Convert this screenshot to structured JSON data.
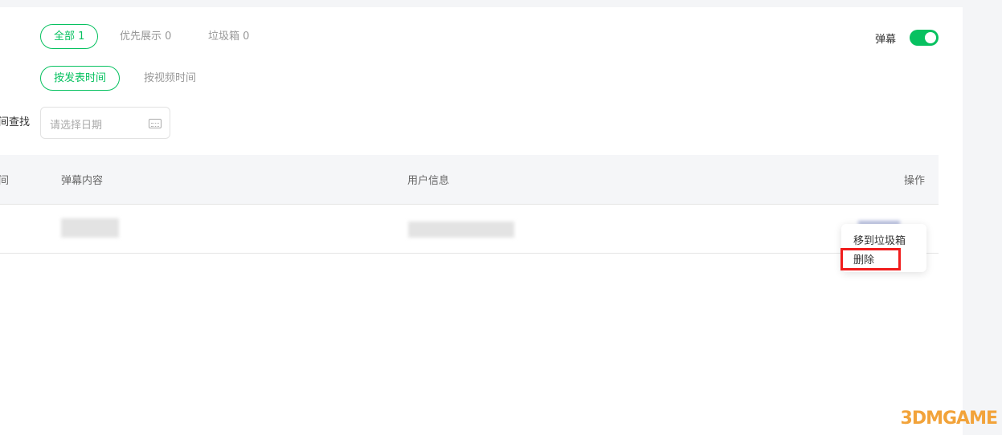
{
  "filters": {
    "tabs": [
      {
        "label": "全部 1",
        "active": true
      },
      {
        "label": "优先展示 0"
      },
      {
        "label": "垃圾箱 0"
      }
    ],
    "sort": [
      {
        "label": "按发表时间",
        "active": true
      },
      {
        "label": "按视频时间"
      }
    ],
    "date_label": "间查找",
    "date_placeholder": "请选择日期"
  },
  "danmaku_toggle": {
    "label": "弹幕",
    "on": true
  },
  "table": {
    "headers": [
      "间",
      "弹幕内容",
      "用户信息",
      "操作"
    ]
  },
  "menu": {
    "items": [
      "移到垃圾箱",
      "删除"
    ],
    "highlighted": "删除"
  },
  "watermark": "3DMGAME",
  "colors": {
    "accent": "#07c160",
    "highlight": "#f01c1c"
  }
}
